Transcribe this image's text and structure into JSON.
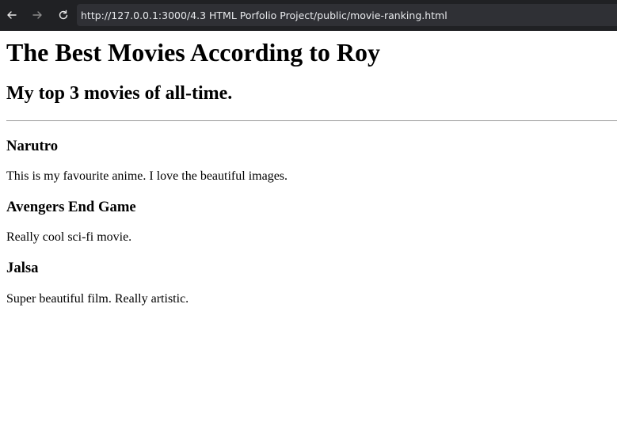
{
  "browser": {
    "url": "http://127.0.0.1:3000/4.3 HTML Porfolio Project/public/movie-ranking.html",
    "icons": {
      "back": "arrow-left-icon",
      "forward": "arrow-right-icon",
      "reload": "reload-icon"
    },
    "colors": {
      "toolbar": "#202124",
      "address_bar": "#2f3035",
      "text": "#e8eaed"
    }
  },
  "page": {
    "title": "The Best Movies According to Roy",
    "subtitle": "My top 3 movies of all-time.",
    "movies": [
      {
        "title": "Narutro",
        "description": "This is my favourite anime. I love the beautiful images."
      },
      {
        "title": "Avengers End Game",
        "description": "Really cool sci-fi movie."
      },
      {
        "title": "Jalsa",
        "description": "Super beautiful film. Really artistic."
      }
    ]
  }
}
